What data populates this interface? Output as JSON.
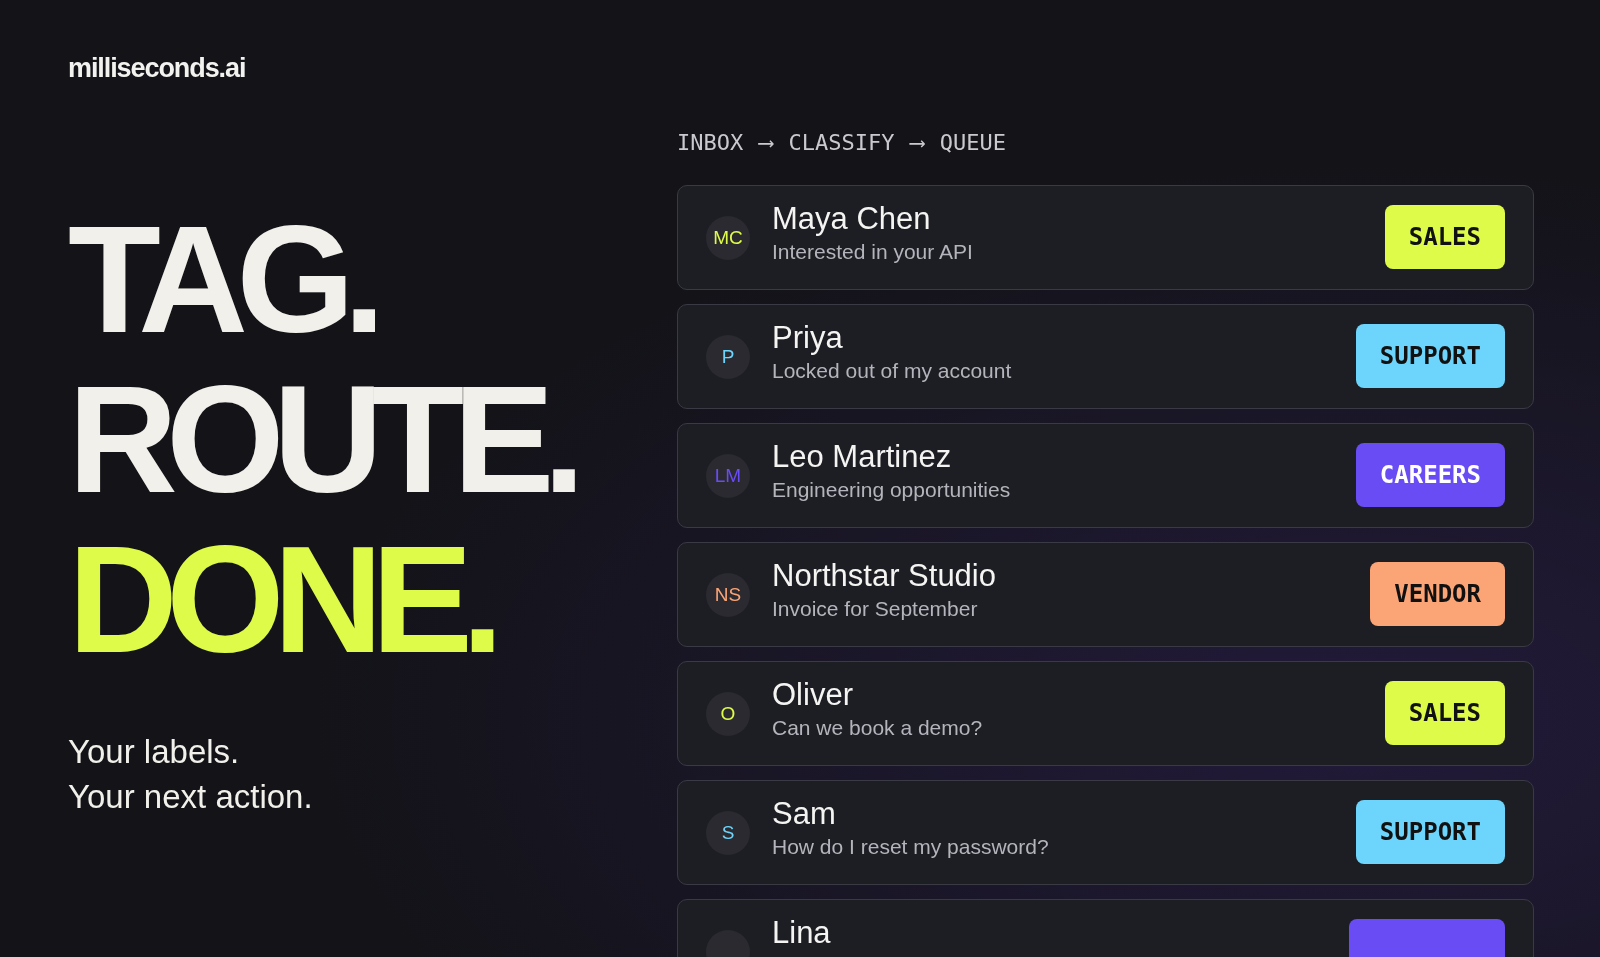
{
  "logo": "milliseconds.ai",
  "headline": [
    {
      "text": "TAG.",
      "accent": false
    },
    {
      "text": "ROUTE.",
      "accent": false
    },
    {
      "text": "DONE.",
      "accent": true
    }
  ],
  "tagline": [
    "Your labels.",
    "Your next action."
  ],
  "pipeline": {
    "steps": [
      "INBOX",
      "CLASSIFY",
      "QUEUE"
    ],
    "separator": "⟶"
  },
  "emails": [
    {
      "initials": "MC",
      "name": "Maya Chen",
      "subject": "Interested in your API",
      "tag": "SALES",
      "color": "#dffb4a"
    },
    {
      "initials": "P",
      "name": "Priya",
      "subject": "Locked out of my account",
      "tag": "SUPPORT",
      "color": "#6dd5fb"
    },
    {
      "initials": "LM",
      "name": "Leo Martinez",
      "subject": "Engineering opportunities",
      "tag": "CAREERS",
      "color": "#6a4cf5"
    },
    {
      "initials": "NS",
      "name": "Northstar Studio",
      "subject": "Invoice for September",
      "tag": "VENDOR",
      "color": "#fba577"
    },
    {
      "initials": "O",
      "name": "Oliver",
      "subject": "Can we book a demo?",
      "tag": "SALES",
      "color": "#dffb4a"
    },
    {
      "initials": "S",
      "name": "Sam",
      "subject": "How do I reset my password?",
      "tag": "SUPPORT",
      "color": "#6dd5fb"
    },
    {
      "name": "Lina",
      "color": "#6a4cf5"
    }
  ]
}
